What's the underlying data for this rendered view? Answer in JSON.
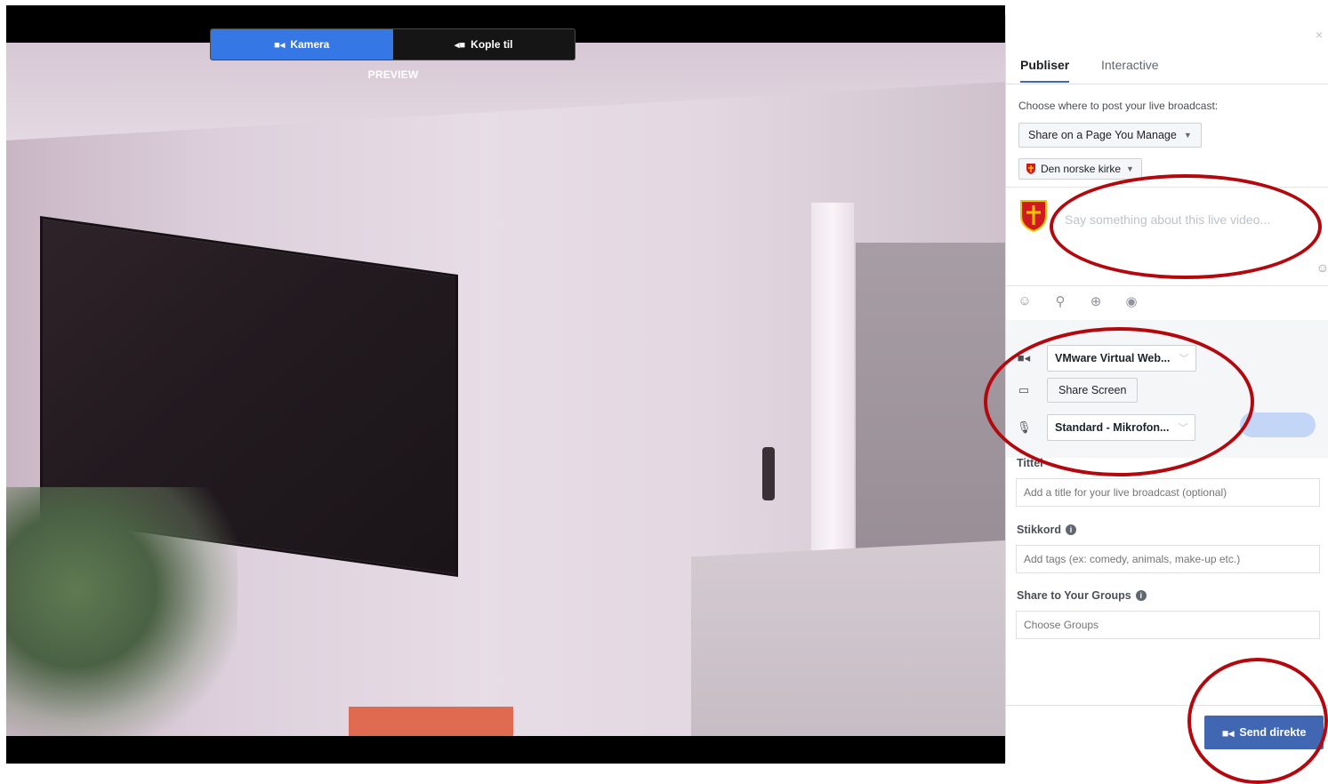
{
  "preview": {
    "tabs": [
      {
        "label": "Kamera",
        "icon": "video-camera-icon",
        "active": true
      },
      {
        "label": "Kople til",
        "icon": "connect-icon",
        "active": false
      }
    ],
    "label": "PREVIEW"
  },
  "panel": {
    "close_icon": "×",
    "tabs": [
      {
        "label": "Publiser",
        "active": true
      },
      {
        "label": "Interactive",
        "active": false
      }
    ],
    "choose_where": "Choose where to post your live broadcast:",
    "share_dropdown": "Share on a Page You Manage",
    "page_dropdown": "Den norske kirke",
    "compose_placeholder": "Say something about this live video...",
    "settings": {
      "camera_select": "VMware Virtual Web...",
      "share_screen": "Share Screen",
      "mic_select": "Standard - Mikrofon..."
    },
    "title_label": "Tittel",
    "title_placeholder": "Add a title for your live broadcast (optional)",
    "tags_label": "Stikkord",
    "tags_placeholder": "Add tags (ex: comedy, animals, make-up etc.)",
    "groups_label": "Share to Your Groups",
    "groups_placeholder": "Choose Groups",
    "send_button": "Send direkte"
  },
  "colors": {
    "accent": "#4267b2",
    "active_tab": "#3578e5",
    "annotation": "#b3080e"
  }
}
